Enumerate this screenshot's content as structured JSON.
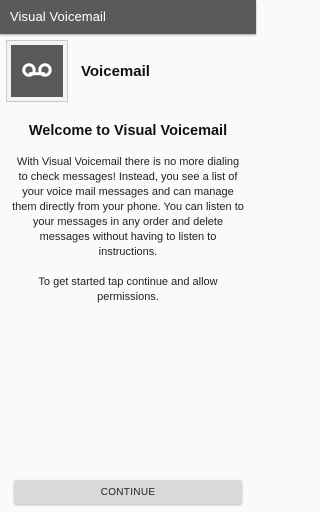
{
  "appbar": {
    "title": "Visual Voicemail"
  },
  "header": {
    "icon": "voicemail-icon",
    "title": "Voicemail"
  },
  "main": {
    "heading": "Welcome to Visual Voicemail",
    "paragraph_1": "With Visual Voicemail there is no more dialing to check messages! Instead, you see a list of your voice mail messages and can manage them directly from your phone. You can listen to your messages in any order and delete messages without having to listen to instructions.",
    "paragraph_2": "To get started tap continue and allow permissions."
  },
  "footer": {
    "continue_label": "CONTINUE"
  },
  "colors": {
    "appbar": "#5a5a5a",
    "background": "#fafafa",
    "button": "#d9d9d9",
    "icon_bg": "#595959"
  }
}
